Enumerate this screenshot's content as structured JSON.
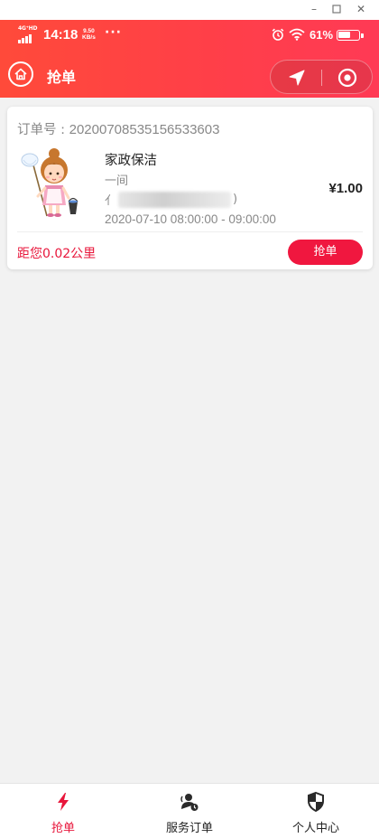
{
  "window": {
    "minimize_icon": "minimize-icon",
    "maximize_icon": "maximize-icon",
    "close_icon": "close-icon"
  },
  "status_bar": {
    "network": "4G⁺HD",
    "time": "14:18",
    "speed_value": "9.50",
    "speed_unit": "KB/s",
    "more": "···",
    "battery": "61%",
    "battery_level": 0.61
  },
  "nav": {
    "title": "抢单",
    "home_icon": "home-icon",
    "location_icon": "navigation-icon",
    "record_icon": "target-icon"
  },
  "order": {
    "number_label": "订单号 : ",
    "number": "20200708535156533603",
    "service_name": "家政保洁",
    "quantity": "一间",
    "address_prefix": "亻",
    "address_suffix": ")",
    "time": "2020-07-10 08:00:00 - 09:00:00",
    "price": "¥1.00",
    "distance": "距您0.02公里",
    "grab_label": "抢单"
  },
  "tabs": [
    {
      "label": "抢单",
      "icon": "lightning-icon",
      "active": true
    },
    {
      "label": "服务订单",
      "icon": "service-order-icon",
      "active": false
    },
    {
      "label": "个人中心",
      "icon": "shield-icon",
      "active": false
    }
  ],
  "colors": {
    "accent": "#e8163b",
    "header_start": "#ff4a3a",
    "header_end": "#ff3a55",
    "background": "#f2f2f2"
  }
}
